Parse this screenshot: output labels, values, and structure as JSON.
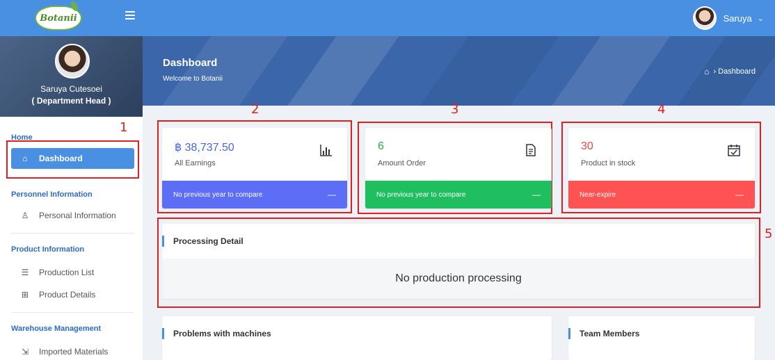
{
  "topbar": {
    "logo_text": "Botanii",
    "user_name": "Saruya",
    "chevron": "⌄"
  },
  "sidebar": {
    "profile_name": "Saruya Cutesoei",
    "profile_role": "( Department Head )",
    "sections": [
      {
        "title": "Home",
        "items": [
          {
            "label": "Dashboard",
            "icon": "home-icon",
            "active": true
          }
        ]
      },
      {
        "title": "Personnel Information",
        "items": [
          {
            "label": "Personal Information",
            "icon": "user-icon"
          }
        ]
      },
      {
        "title": "Product Information",
        "items": [
          {
            "label": "Production List",
            "icon": "list-icon"
          },
          {
            "label": "Product Details",
            "icon": "grid-icon"
          }
        ]
      },
      {
        "title": "Warehouse Management",
        "items": [
          {
            "label": "Imported Materials",
            "icon": "import-icon"
          }
        ]
      }
    ]
  },
  "hero": {
    "title": "Dashboard",
    "subtitle": "Welcome to Botanii",
    "breadcrumb": "› Dashboard"
  },
  "annotations": [
    "1",
    "2",
    "3",
    "4",
    "5"
  ],
  "stats": [
    {
      "value": "฿ 38,737.50",
      "label": "All Earnings",
      "footer": "No previous year to compare",
      "color": "#5b6ef5",
      "value_color": "#4a63e8",
      "icon": "bar-chart-icon"
    },
    {
      "value": "6",
      "label": "Amount Order",
      "footer": "No previous year to compare",
      "color": "#1fbf5f",
      "value_color": "#1fa84f",
      "icon": "document-icon"
    },
    {
      "value": "30",
      "label": "Product in stock",
      "footer": "Near-expire",
      "color": "#ff5252",
      "value_color": "#f04848",
      "icon": "calendar-check-icon"
    }
  ],
  "stat_footer_dash": "—",
  "processing": {
    "title": "Processing Detail",
    "message": "No production processing"
  },
  "problems": {
    "title": "Problems with machines"
  },
  "team": {
    "title": "Team Members"
  }
}
